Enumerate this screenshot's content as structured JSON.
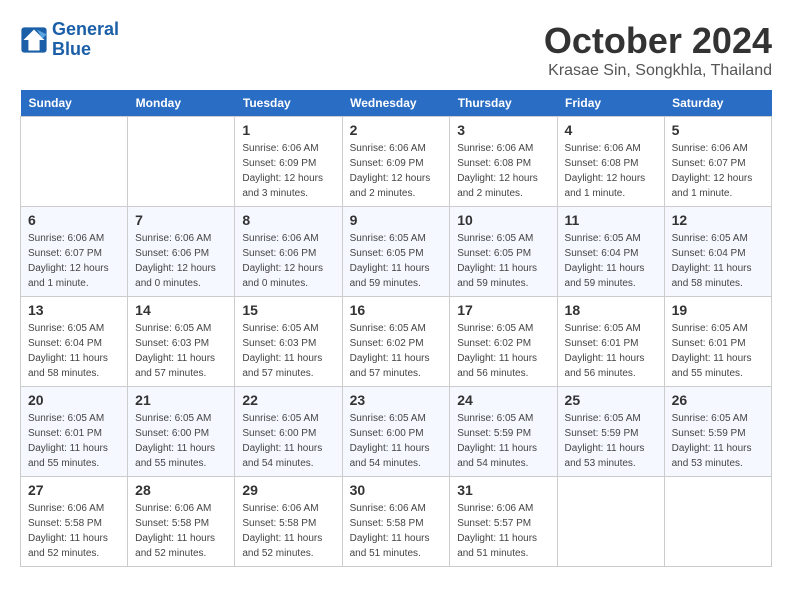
{
  "header": {
    "logo_line1": "General",
    "logo_line2": "Blue",
    "month": "October 2024",
    "location": "Krasae Sin, Songkhla, Thailand"
  },
  "days_of_week": [
    "Sunday",
    "Monday",
    "Tuesday",
    "Wednesday",
    "Thursday",
    "Friday",
    "Saturday"
  ],
  "weeks": [
    [
      {
        "num": "",
        "detail": ""
      },
      {
        "num": "",
        "detail": ""
      },
      {
        "num": "1",
        "detail": "Sunrise: 6:06 AM\nSunset: 6:09 PM\nDaylight: 12 hours\nand 3 minutes."
      },
      {
        "num": "2",
        "detail": "Sunrise: 6:06 AM\nSunset: 6:09 PM\nDaylight: 12 hours\nand 2 minutes."
      },
      {
        "num": "3",
        "detail": "Sunrise: 6:06 AM\nSunset: 6:08 PM\nDaylight: 12 hours\nand 2 minutes."
      },
      {
        "num": "4",
        "detail": "Sunrise: 6:06 AM\nSunset: 6:08 PM\nDaylight: 12 hours\nand 1 minute."
      },
      {
        "num": "5",
        "detail": "Sunrise: 6:06 AM\nSunset: 6:07 PM\nDaylight: 12 hours\nand 1 minute."
      }
    ],
    [
      {
        "num": "6",
        "detail": "Sunrise: 6:06 AM\nSunset: 6:07 PM\nDaylight: 12 hours\nand 1 minute."
      },
      {
        "num": "7",
        "detail": "Sunrise: 6:06 AM\nSunset: 6:06 PM\nDaylight: 12 hours\nand 0 minutes."
      },
      {
        "num": "8",
        "detail": "Sunrise: 6:06 AM\nSunset: 6:06 PM\nDaylight: 12 hours\nand 0 minutes."
      },
      {
        "num": "9",
        "detail": "Sunrise: 6:05 AM\nSunset: 6:05 PM\nDaylight: 11 hours\nand 59 minutes."
      },
      {
        "num": "10",
        "detail": "Sunrise: 6:05 AM\nSunset: 6:05 PM\nDaylight: 11 hours\nand 59 minutes."
      },
      {
        "num": "11",
        "detail": "Sunrise: 6:05 AM\nSunset: 6:04 PM\nDaylight: 11 hours\nand 59 minutes."
      },
      {
        "num": "12",
        "detail": "Sunrise: 6:05 AM\nSunset: 6:04 PM\nDaylight: 11 hours\nand 58 minutes."
      }
    ],
    [
      {
        "num": "13",
        "detail": "Sunrise: 6:05 AM\nSunset: 6:04 PM\nDaylight: 11 hours\nand 58 minutes."
      },
      {
        "num": "14",
        "detail": "Sunrise: 6:05 AM\nSunset: 6:03 PM\nDaylight: 11 hours\nand 57 minutes."
      },
      {
        "num": "15",
        "detail": "Sunrise: 6:05 AM\nSunset: 6:03 PM\nDaylight: 11 hours\nand 57 minutes."
      },
      {
        "num": "16",
        "detail": "Sunrise: 6:05 AM\nSunset: 6:02 PM\nDaylight: 11 hours\nand 57 minutes."
      },
      {
        "num": "17",
        "detail": "Sunrise: 6:05 AM\nSunset: 6:02 PM\nDaylight: 11 hours\nand 56 minutes."
      },
      {
        "num": "18",
        "detail": "Sunrise: 6:05 AM\nSunset: 6:01 PM\nDaylight: 11 hours\nand 56 minutes."
      },
      {
        "num": "19",
        "detail": "Sunrise: 6:05 AM\nSunset: 6:01 PM\nDaylight: 11 hours\nand 55 minutes."
      }
    ],
    [
      {
        "num": "20",
        "detail": "Sunrise: 6:05 AM\nSunset: 6:01 PM\nDaylight: 11 hours\nand 55 minutes."
      },
      {
        "num": "21",
        "detail": "Sunrise: 6:05 AM\nSunset: 6:00 PM\nDaylight: 11 hours\nand 55 minutes."
      },
      {
        "num": "22",
        "detail": "Sunrise: 6:05 AM\nSunset: 6:00 PM\nDaylight: 11 hours\nand 54 minutes."
      },
      {
        "num": "23",
        "detail": "Sunrise: 6:05 AM\nSunset: 6:00 PM\nDaylight: 11 hours\nand 54 minutes."
      },
      {
        "num": "24",
        "detail": "Sunrise: 6:05 AM\nSunset: 5:59 PM\nDaylight: 11 hours\nand 54 minutes."
      },
      {
        "num": "25",
        "detail": "Sunrise: 6:05 AM\nSunset: 5:59 PM\nDaylight: 11 hours\nand 53 minutes."
      },
      {
        "num": "26",
        "detail": "Sunrise: 6:05 AM\nSunset: 5:59 PM\nDaylight: 11 hours\nand 53 minutes."
      }
    ],
    [
      {
        "num": "27",
        "detail": "Sunrise: 6:06 AM\nSunset: 5:58 PM\nDaylight: 11 hours\nand 52 minutes."
      },
      {
        "num": "28",
        "detail": "Sunrise: 6:06 AM\nSunset: 5:58 PM\nDaylight: 11 hours\nand 52 minutes."
      },
      {
        "num": "29",
        "detail": "Sunrise: 6:06 AM\nSunset: 5:58 PM\nDaylight: 11 hours\nand 52 minutes."
      },
      {
        "num": "30",
        "detail": "Sunrise: 6:06 AM\nSunset: 5:58 PM\nDaylight: 11 hours\nand 51 minutes."
      },
      {
        "num": "31",
        "detail": "Sunrise: 6:06 AM\nSunset: 5:57 PM\nDaylight: 11 hours\nand 51 minutes."
      },
      {
        "num": "",
        "detail": ""
      },
      {
        "num": "",
        "detail": ""
      }
    ]
  ]
}
